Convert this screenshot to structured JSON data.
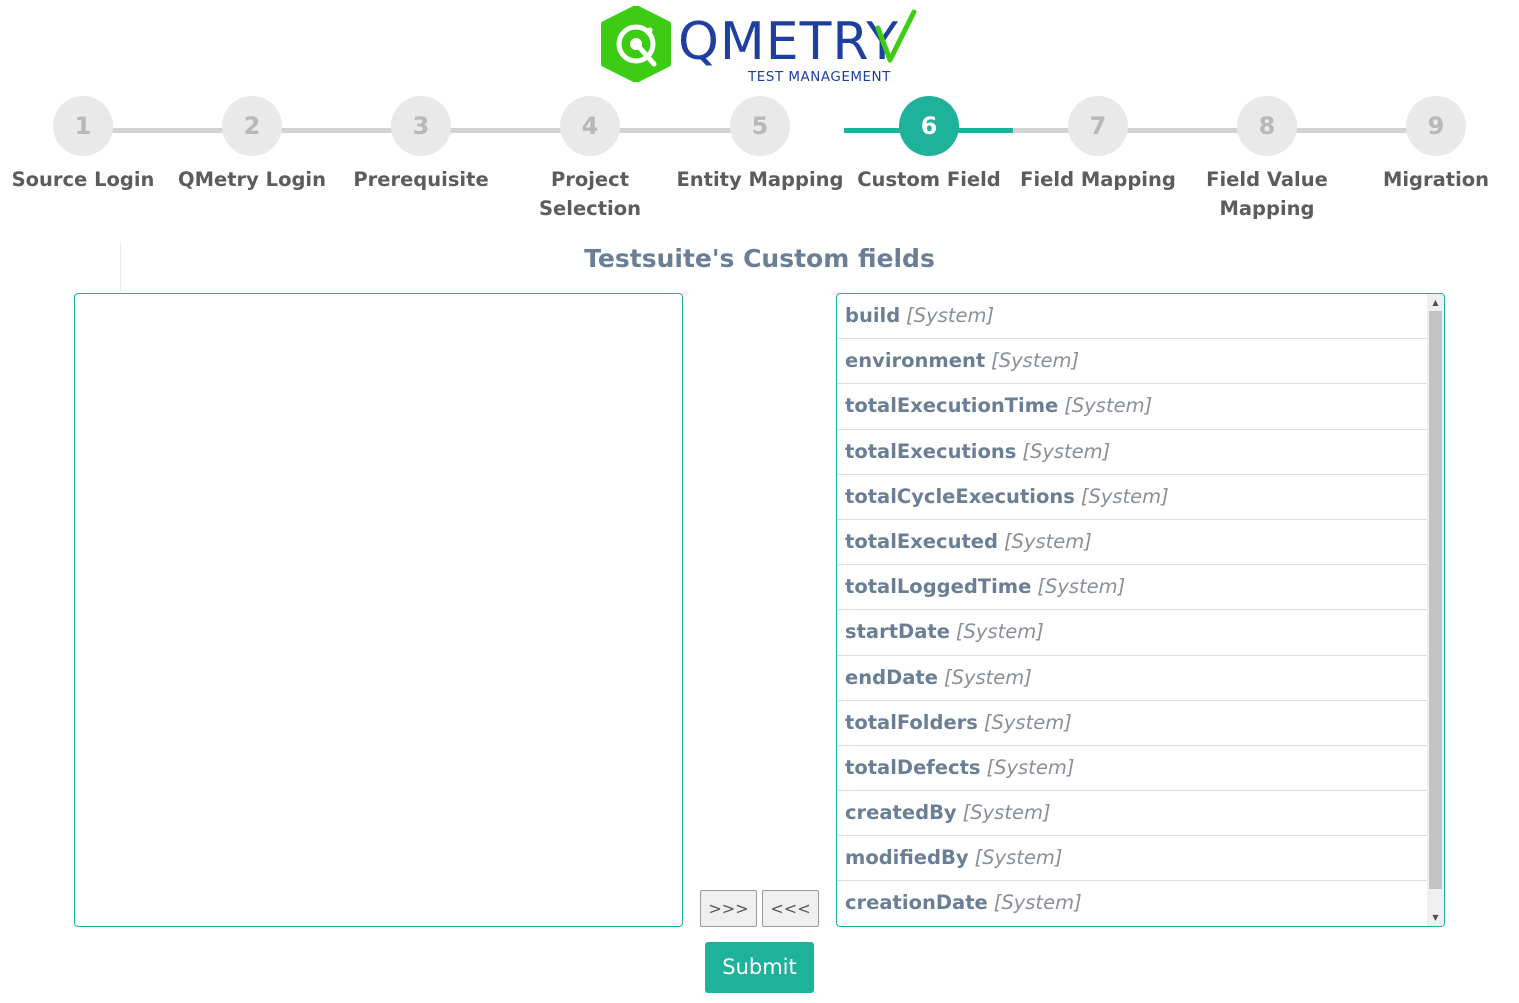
{
  "brand": {
    "name": "QMETRY",
    "subtitle": "TEST MANAGEMENT",
    "green": "#3ccc14",
    "blue": "#1e3fa0"
  },
  "stepper": {
    "active_step": 6,
    "accent": "#1eb29a",
    "steps": [
      {
        "number": "1",
        "label": "Source Login"
      },
      {
        "number": "2",
        "label": "QMetry Login"
      },
      {
        "number": "3",
        "label": "Prerequisite"
      },
      {
        "number": "4",
        "label": "Project Selection"
      },
      {
        "number": "5",
        "label": "Entity Mapping"
      },
      {
        "number": "6",
        "label": "Custom Field"
      },
      {
        "number": "7",
        "label": "Field Mapping"
      },
      {
        "number": "8",
        "label": "Field Value Mapping"
      },
      {
        "number": "9",
        "label": "Migration"
      }
    ]
  },
  "main": {
    "title": "Testsuite's Custom fields",
    "left_list": {
      "items": []
    },
    "right_list": {
      "items": [
        {
          "name": "build",
          "tag": "[System]"
        },
        {
          "name": "environment",
          "tag": "[System]"
        },
        {
          "name": "totalExecutionTime",
          "tag": "[System]"
        },
        {
          "name": "totalExecutions",
          "tag": "[System]"
        },
        {
          "name": "totalCycleExecutions",
          "tag": "[System]"
        },
        {
          "name": "totalExecuted",
          "tag": "[System]"
        },
        {
          "name": "totalLoggedTime",
          "tag": "[System]"
        },
        {
          "name": "startDate",
          "tag": "[System]"
        },
        {
          "name": "endDate",
          "tag": "[System]"
        },
        {
          "name": "totalFolders",
          "tag": "[System]"
        },
        {
          "name": "totalDefects",
          "tag": "[System]"
        },
        {
          "name": "createdBy",
          "tag": "[System]"
        },
        {
          "name": "modifiedBy",
          "tag": "[System]"
        },
        {
          "name": "creationDate",
          "tag": "[System]"
        }
      ]
    },
    "move_right_label": ">>>",
    "move_left_label": "<<<",
    "submit_label": "Submit"
  }
}
